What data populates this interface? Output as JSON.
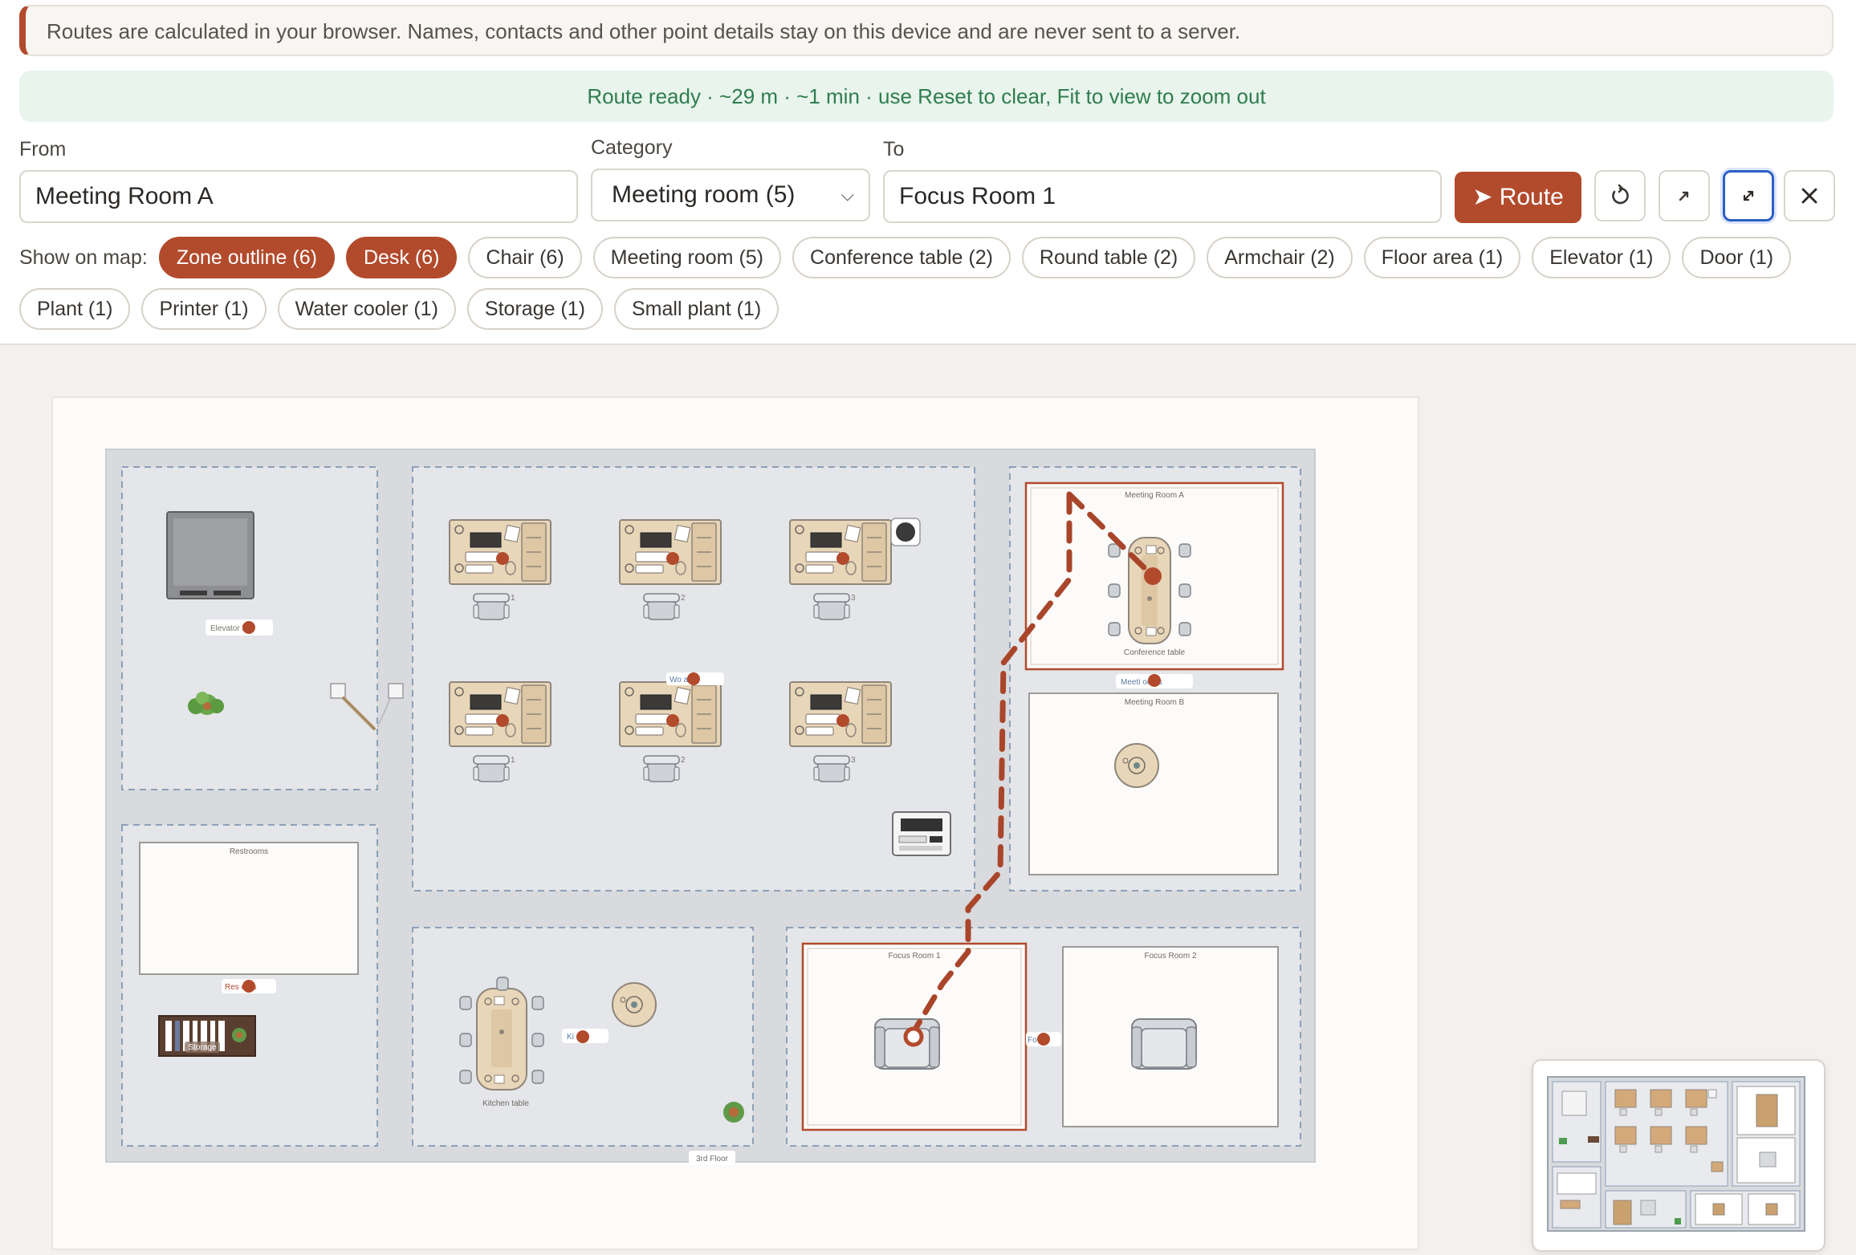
{
  "privacy_notice": "Routes are calculated in your browser. Names, contacts and other point details stay on this device and are never sent to a server.",
  "route_status": "Route ready · ~29 m · ~1 min · use Reset to clear, Fit to view to zoom out",
  "form": {
    "from_label": "From",
    "from_value": "Meeting Room A",
    "category_label": "Category",
    "category_value": "Meeting room (5)",
    "to_label": "To",
    "to_value": "Focus Room 1",
    "route_button": "➤ Route"
  },
  "toolbar": {
    "reset_icon": "reset-icon",
    "share_icon": "arrow-up-right-icon",
    "fit_icon": "fit-to-view-icon",
    "close_icon": "close-icon"
  },
  "filters": {
    "label": "Show on map:",
    "chips": [
      {
        "label": "Zone outline (6)",
        "active": true
      },
      {
        "label": "Desk (6)",
        "active": true
      },
      {
        "label": "Chair (6)",
        "active": false
      },
      {
        "label": "Meeting room (5)",
        "active": false
      },
      {
        "label": "Conference table (2)",
        "active": false
      },
      {
        "label": "Round table (2)",
        "active": false
      },
      {
        "label": "Armchair (2)",
        "active": false
      },
      {
        "label": "Floor area (1)",
        "active": false
      },
      {
        "label": "Elevator (1)",
        "active": false
      },
      {
        "label": "Door (1)",
        "active": false
      },
      {
        "label": "Plant (1)",
        "active": false
      },
      {
        "label": "Printer (1)",
        "active": false
      },
      {
        "label": "Water cooler (1)",
        "active": false
      },
      {
        "label": "Storage (1)",
        "active": false
      },
      {
        "label": "Small plant (1)",
        "active": false
      }
    ]
  },
  "map": {
    "floor_label": "3rd Floor",
    "rooms": {
      "meeting_a": "Meeting Room A",
      "meeting_b": "Meeting Room B",
      "focus_1": "Focus Room 1",
      "focus_2": "Focus Room 2",
      "restrooms": "Restrooms"
    },
    "labels": {
      "conference_table": "Conference table",
      "kitchen_table": "Kitchen table",
      "storage": "Storage",
      "elevator_tag": "Elevator   by",
      "restrooms_tag": "Res      oms",
      "meeting_tag": "Meeti        ooms",
      "workspace_tag": "Wo        ace",
      "kitchen_tag": "Ki      n",
      "focus_tag": "Fo       or",
      "desk_numbers": [
        "1",
        "2",
        "3",
        "1",
        "2",
        "3"
      ]
    },
    "colors": {
      "accent": "#b24a2c",
      "route": "#a9452a",
      "wood": "#e8d6b8",
      "zone": "#e3e6ea"
    }
  }
}
